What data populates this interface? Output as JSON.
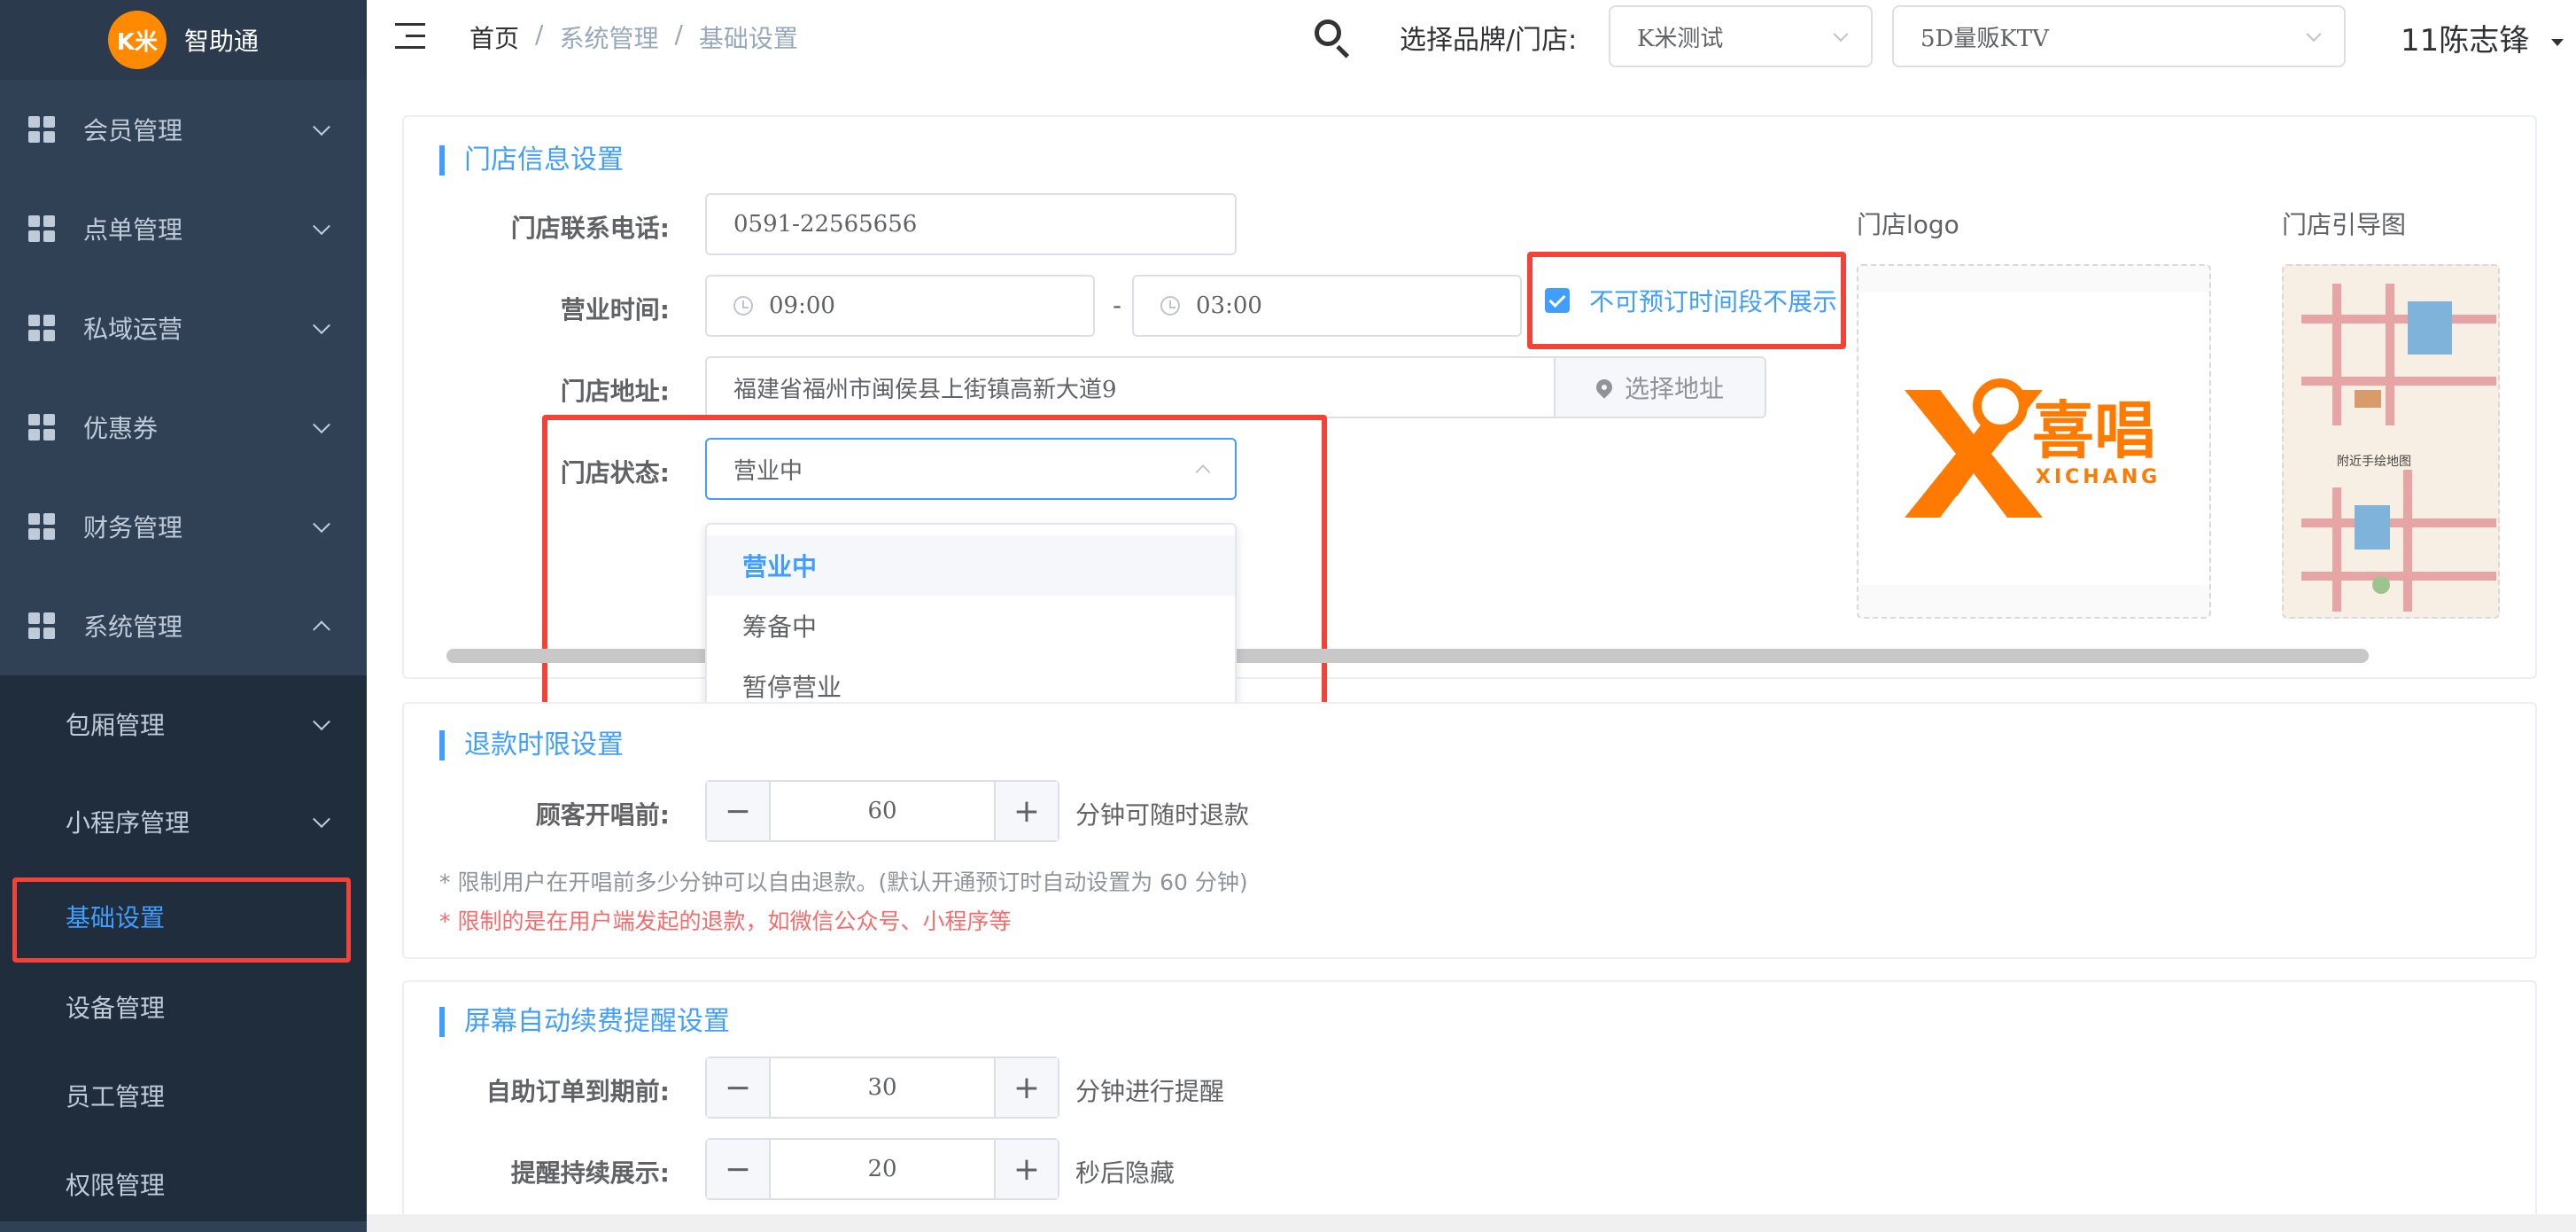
{
  "app": {
    "logo_badge": "K米",
    "name": "智助通"
  },
  "sidebar": {
    "items": [
      {
        "label": "会员管理"
      },
      {
        "label": "点单管理"
      },
      {
        "label": "私域运营"
      },
      {
        "label": "优惠券"
      },
      {
        "label": "财务管理"
      },
      {
        "label": "系统管理"
      }
    ],
    "sub_items": [
      {
        "label": "包厢管理"
      },
      {
        "label": "小程序管理"
      },
      {
        "label": "基础设置"
      },
      {
        "label": "设备管理"
      },
      {
        "label": "员工管理"
      },
      {
        "label": "权限管理"
      }
    ]
  },
  "header": {
    "breadcrumb": [
      "首页",
      "/",
      "系统管理",
      "/",
      "基础设置"
    ],
    "brand_label": "选择品牌/门店:",
    "brand_select": "K米测试",
    "store_select": "5D量贩KTV",
    "username": "11陈志锋"
  },
  "store_info": {
    "title": "门店信息设置",
    "phone_label": "门店联系电话:",
    "phone_value": "0591-22565656",
    "hours_label": "营业时间:",
    "open_time": "09:00",
    "hours_separator": "-",
    "close_time": "03:00",
    "hide_unbookable_label": "不可预订时间段不展示",
    "hide_unbookable_checked": true,
    "address_label": "门店地址:",
    "address_value": "福建省福州市闽侯县上街镇高新大道9",
    "select_address_button": "选择地址",
    "status_label": "门店状态:",
    "status_value": "营业中",
    "status_options": [
      "营业中",
      "筹备中",
      "暂停营业"
    ],
    "logo_label": "门店logo",
    "logo_brand_cn": "喜唱",
    "logo_brand_en": "XICHANG",
    "guide_label": "门店引导图",
    "guide_map_text": "附近手绘地图"
  },
  "refund": {
    "title": "退款时限设置",
    "before_label": "顾客开唱前:",
    "minutes": "60",
    "suffix": "分钟可随时退款",
    "note1": "* 限制用户在开唱前多少分钟可以自由退款。(默认开通预订时自动设置为 60 分钟)",
    "note2": "* 限制的是在用户端发起的退款，如微信公众号、小程序等"
  },
  "screen_reminder": {
    "title": "屏幕自动续费提醒设置",
    "expire_label": "自助订单到期前:",
    "expire_minutes": "30",
    "expire_suffix": "分钟进行提醒",
    "display_label": "提醒持续展示:",
    "display_seconds": "20",
    "display_suffix": "秒后隐藏"
  },
  "colors": {
    "accent": "#409eff",
    "highlight": "#f44336",
    "sidebar": "#304156",
    "logo_orange": "#ff7a00"
  }
}
